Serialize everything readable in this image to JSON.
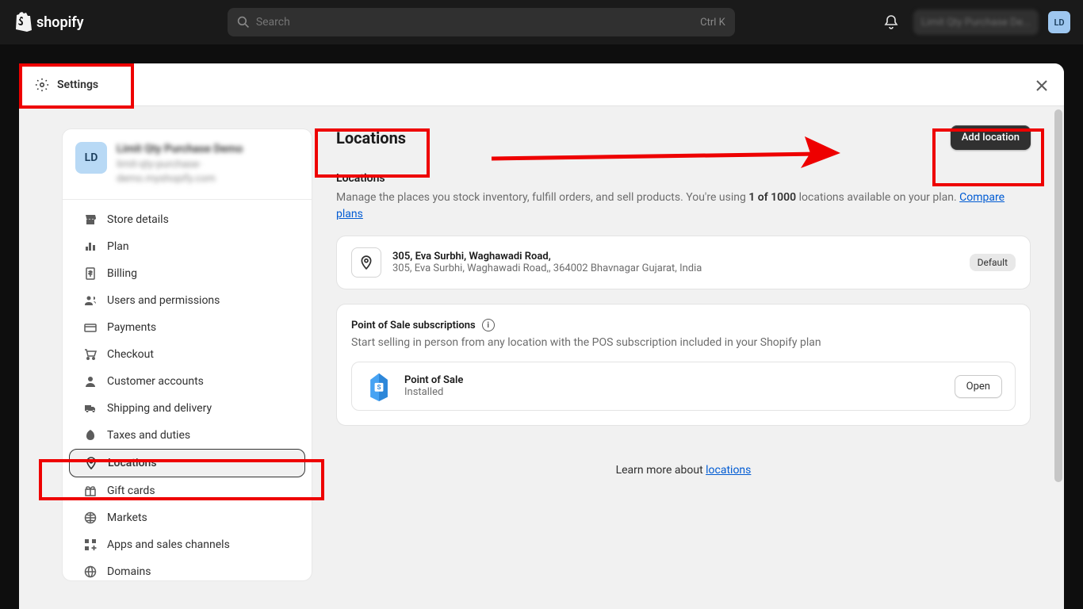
{
  "brand": "shopify",
  "search": {
    "placeholder": "Search",
    "shortcut": "Ctrl K"
  },
  "avatar_initials": "LD",
  "modal_title": "Settings",
  "store": {
    "initials": "LD",
    "name": "Limit Qty Purchase Demo",
    "domain": "limit-qty-purchase-demo.myshopify.com"
  },
  "nav": [
    {
      "label": "Store details",
      "icon": "store"
    },
    {
      "label": "Plan",
      "icon": "plan"
    },
    {
      "label": "Billing",
      "icon": "billing"
    },
    {
      "label": "Users and permissions",
      "icon": "users"
    },
    {
      "label": "Payments",
      "icon": "payments"
    },
    {
      "label": "Checkout",
      "icon": "checkout"
    },
    {
      "label": "Customer accounts",
      "icon": "customer"
    },
    {
      "label": "Shipping and delivery",
      "icon": "shipping"
    },
    {
      "label": "Taxes and duties",
      "icon": "taxes"
    },
    {
      "label": "Locations",
      "icon": "location",
      "active": true
    },
    {
      "label": "Gift cards",
      "icon": "gift"
    },
    {
      "label": "Markets",
      "icon": "markets"
    },
    {
      "label": "Apps and sales channels",
      "icon": "apps"
    },
    {
      "label": "Domains",
      "icon": "domains"
    }
  ],
  "page": {
    "title": "Locations",
    "add_button": "Add location",
    "section_title": "Locations",
    "desc_pre": "Manage the places you stock inventory, fulfill orders, and sell products. You're using ",
    "desc_bold": "1 of 1000",
    "desc_post": " locations available on your plan. ",
    "compare_link": "Compare plans"
  },
  "location": {
    "title": "305, Eva Surbhi, Waghawadi Road,",
    "address": "305, Eva Surbhi, Waghawadi Road,, 364002 Bhavnagar Gujarat, India",
    "badge": "Default"
  },
  "pos": {
    "heading": "Point of Sale subscriptions",
    "desc": "Start selling in person from any location with the POS subscription included in your Shopify plan",
    "app_name": "Point of Sale",
    "status": "Installed",
    "open": "Open"
  },
  "learn": {
    "pre": "Learn more about ",
    "link": "locations"
  }
}
